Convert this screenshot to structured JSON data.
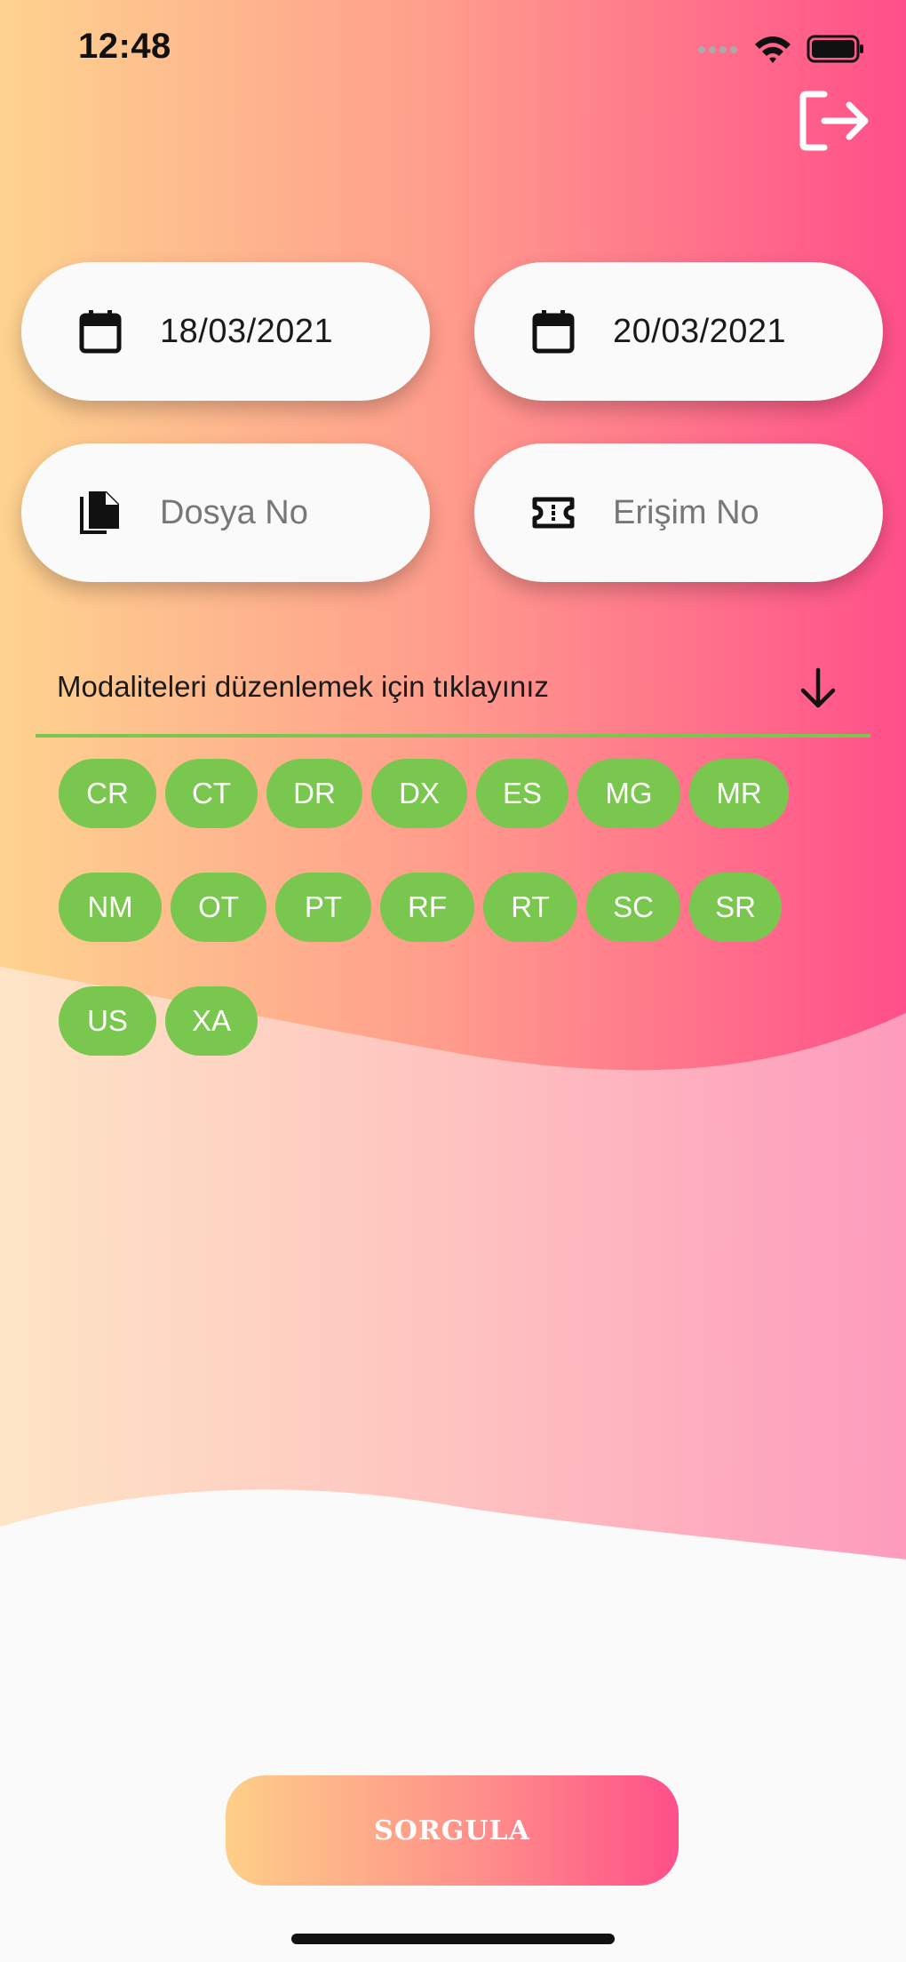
{
  "status_bar": {
    "time": "12:48"
  },
  "dates": {
    "start": "18/03/2021",
    "end": "20/03/2021"
  },
  "fields": {
    "dosya_placeholder": "Dosya No",
    "erisim_placeholder": "Erişim No"
  },
  "modality_dropdown": {
    "label": "Modaliteleri düzenlemek için tıklayınız"
  },
  "modalities": [
    [
      "CR",
      "CT",
      "DR",
      "DX",
      "ES",
      "MG",
      "MR"
    ],
    [
      "NM",
      "OT",
      "PT",
      "RF",
      "RT",
      "SC",
      "SR"
    ],
    [
      "US",
      "XA"
    ]
  ],
  "submit_label": "SORGULA",
  "colors": {
    "gradient_start": "#fecf88",
    "gradient_end": "#ff4f8a",
    "chip": "#7ac74f",
    "field_bg": "#fafafa"
  },
  "icons": [
    "logout-icon",
    "calendar-icon",
    "file-copy-icon",
    "ticket-icon",
    "arrow-down-icon",
    "wifi-icon",
    "battery-icon"
  ]
}
